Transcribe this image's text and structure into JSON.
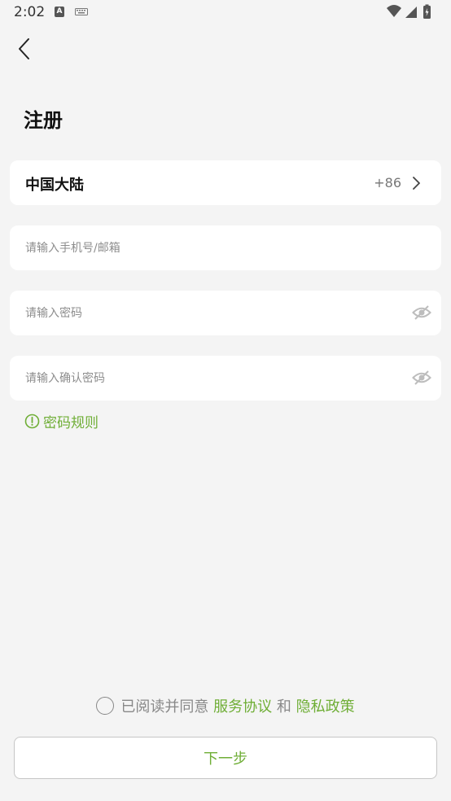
{
  "status_bar": {
    "time": "2:02",
    "a_icon_label": "A"
  },
  "page": {
    "title": "注册"
  },
  "region": {
    "name": "中国大陆",
    "code": "+86"
  },
  "fields": {
    "account_placeholder": "请输入手机号/邮箱",
    "password_placeholder": "请输入密码",
    "confirm_placeholder": "请输入确认密码"
  },
  "password_rules": {
    "label": "密码规则"
  },
  "agreement": {
    "prefix": "已阅读并同意",
    "service_link": "服务协议",
    "conjunction": "和",
    "privacy_link": "隐私政策"
  },
  "actions": {
    "next_label": "下一步"
  },
  "colors": {
    "accent": "#6fae36",
    "background": "#f4f4f4",
    "card": "#ffffff"
  },
  "icons": {
    "back": "back-arrow-icon",
    "chevron": "chevron-right-icon",
    "eye": "eye-hidden-icon",
    "info": "info-circle-icon"
  }
}
